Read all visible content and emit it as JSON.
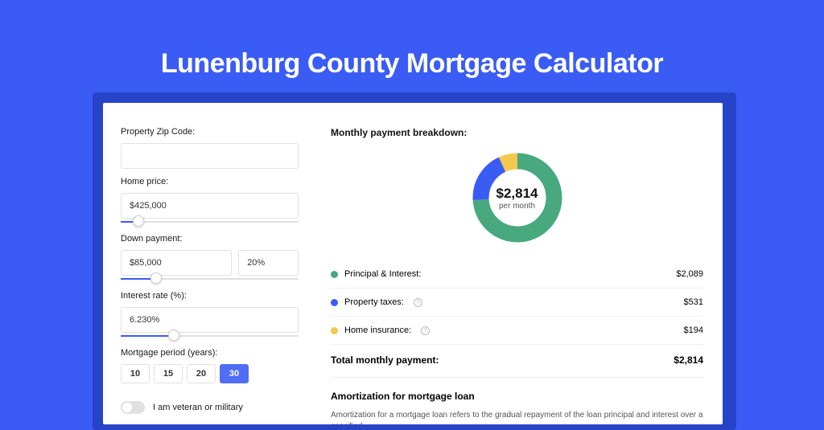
{
  "title": "Lunenburg County Mortgage Calculator",
  "form": {
    "zip": {
      "label": "Property Zip Code:",
      "value": ""
    },
    "home_price": {
      "label": "Home price:",
      "value": "$425,000",
      "slider_pct": 10
    },
    "down_payment": {
      "label": "Down payment:",
      "amount": "$85,000",
      "percent": "20%",
      "slider_pct": 20
    },
    "interest": {
      "label": "Interest rate (%):",
      "value": "6.230%",
      "slider_pct": 30
    },
    "period": {
      "label": "Mortgage period (years):",
      "options": [
        "10",
        "15",
        "20",
        "30"
      ],
      "selected": "30"
    },
    "veteran": {
      "label": "I am veteran or military",
      "on": false
    }
  },
  "breakdown": {
    "title": "Monthly payment breakdown:",
    "center_value": "$2,814",
    "center_sub": "per month",
    "items": [
      {
        "label": "Principal & Interest:",
        "value": "$2,089",
        "color": "#48a97f",
        "info": false,
        "pct": 74
      },
      {
        "label": "Property taxes:",
        "value": "$531",
        "color": "#3a5cf4",
        "info": true,
        "pct": 19
      },
      {
        "label": "Home insurance:",
        "value": "$194",
        "color": "#f2c94c",
        "info": true,
        "pct": 7
      }
    ],
    "total_label": "Total monthly payment:",
    "total_value": "$2,814"
  },
  "amort": {
    "title": "Amortization for mortgage loan",
    "text": "Amortization for a mortgage loan refers to the gradual repayment of the loan principal and interest over a specified"
  },
  "chart_data": {
    "type": "pie",
    "title": "Monthly payment breakdown",
    "series": [
      {
        "name": "Principal & Interest",
        "value": 2089
      },
      {
        "name": "Property taxes",
        "value": 531
      },
      {
        "name": "Home insurance",
        "value": 194
      }
    ],
    "total": 2814,
    "unit": "USD/month"
  }
}
